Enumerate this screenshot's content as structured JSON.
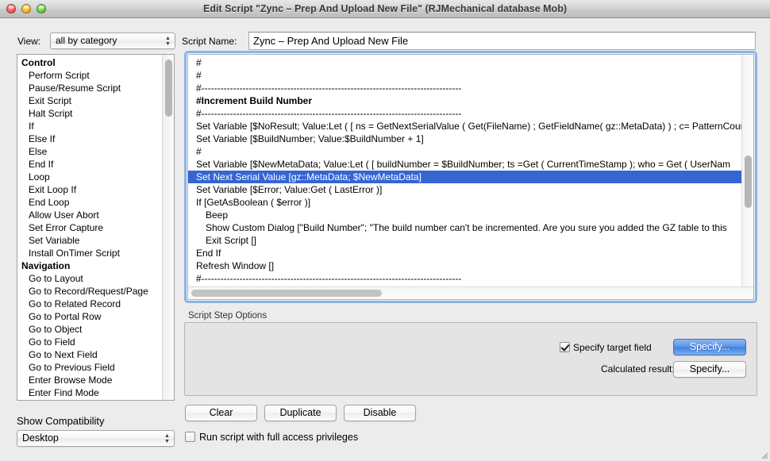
{
  "window": {
    "title": "Edit Script \"Zync – Prep And Upload New File\" (RJMechanical database Mob)",
    "traffic": {
      "close": "close-button",
      "minimize": "minimize-button",
      "zoom": "zoom-button"
    }
  },
  "toolbar": {
    "view_label": "View:",
    "view_value": "all by category",
    "script_name_label": "Script Name:",
    "script_name_value": "Zync – Prep And Upload New File"
  },
  "steps_panel": {
    "items": [
      {
        "label": "Control",
        "category": true
      },
      {
        "label": "Perform Script",
        "category": false
      },
      {
        "label": "Pause/Resume Script",
        "category": false
      },
      {
        "label": "Exit Script",
        "category": false
      },
      {
        "label": "Halt Script",
        "category": false
      },
      {
        "label": "If",
        "category": false
      },
      {
        "label": "Else If",
        "category": false
      },
      {
        "label": "Else",
        "category": false
      },
      {
        "label": "End If",
        "category": false
      },
      {
        "label": "Loop",
        "category": false
      },
      {
        "label": "Exit Loop If",
        "category": false
      },
      {
        "label": "End Loop",
        "category": false
      },
      {
        "label": "Allow User Abort",
        "category": false
      },
      {
        "label": "Set Error Capture",
        "category": false
      },
      {
        "label": "Set Variable",
        "category": false
      },
      {
        "label": "Install OnTimer Script",
        "category": false
      },
      {
        "label": "Navigation",
        "category": true
      },
      {
        "label": "Go to Layout",
        "category": false
      },
      {
        "label": "Go to Record/Request/Page",
        "category": false
      },
      {
        "label": "Go to Related Record",
        "category": false
      },
      {
        "label": "Go to Portal Row",
        "category": false
      },
      {
        "label": "Go to Object",
        "category": false
      },
      {
        "label": "Go to Field",
        "category": false
      },
      {
        "label": "Go to Next Field",
        "category": false
      },
      {
        "label": "Go to Previous Field",
        "category": false
      },
      {
        "label": "Enter Browse Mode",
        "category": false
      },
      {
        "label": "Enter Find Mode",
        "category": false
      }
    ]
  },
  "script_body": {
    "lines": [
      {
        "text": "#",
        "indent": 0,
        "bold": false,
        "selected": false
      },
      {
        "text": "#",
        "indent": 0,
        "bold": false,
        "selected": false
      },
      {
        "text": "#----------------------------------------------------------------------------------",
        "indent": 0,
        "bold": false,
        "selected": false
      },
      {
        "text": "#Increment Build Number",
        "indent": 0,
        "bold": true,
        "selected": false
      },
      {
        "text": "#----------------------------------------------------------------------------------",
        "indent": 0,
        "bold": false,
        "selected": false
      },
      {
        "text": "Set Variable [$NoResult; Value:Let ( [ ns = GetNextSerialValue ( Get(FileName) ; GetFieldName( gz::MetaData) ) ; c= PatternCoun",
        "indent": 0,
        "bold": false,
        "selected": false
      },
      {
        "text": "Set Variable [$BuildNumber; Value:$BuildNumber + 1]",
        "indent": 0,
        "bold": false,
        "selected": false
      },
      {
        "text": "#",
        "indent": 0,
        "bold": false,
        "selected": false
      },
      {
        "text": "Set Variable [$NewMetaData; Value:Let ( [ buildNumber = $BuildNumber;  ts =Get ( CurrentTimeStamp ); who = Get ( UserNam",
        "indent": 0,
        "bold": false,
        "selected": false
      },
      {
        "text": "Set Next Serial Value [gz::MetaData; $NewMetaData]",
        "indent": 0,
        "bold": false,
        "selected": true
      },
      {
        "text": "Set Variable [$Error; Value:Get ( LastError )]",
        "indent": 0,
        "bold": false,
        "selected": false
      },
      {
        "text": "If [GetAsBoolean ( $error )]",
        "indent": 0,
        "bold": false,
        "selected": false
      },
      {
        "text": "Beep",
        "indent": 1,
        "bold": false,
        "selected": false
      },
      {
        "text": "Show Custom Dialog [\"Build Number\"; \"The build number can't be incremented.  Are you sure you added the GZ table to this",
        "indent": 1,
        "bold": false,
        "selected": false
      },
      {
        "text": "Exit Script []",
        "indent": 1,
        "bold": false,
        "selected": false
      },
      {
        "text": "End If",
        "indent": 0,
        "bold": false,
        "selected": false
      },
      {
        "text": "Refresh Window []",
        "indent": 0,
        "bold": false,
        "selected": false
      },
      {
        "text": "#----------------------------------------------------------------------------------",
        "indent": 0,
        "bold": false,
        "selected": false
      },
      {
        "text": "#",
        "indent": 0,
        "bold": false,
        "selected": false
      }
    ]
  },
  "options": {
    "caption": "Script Step Options",
    "specify_target_field_label": "Specify target field",
    "specify_target_field_checked": true,
    "specify_button_1": "Specify...",
    "calculated_result_label": "Calculated result:",
    "specify_button_2": "Specify..."
  },
  "bottom": {
    "clear": "Clear",
    "duplicate": "Duplicate",
    "disable": "Disable",
    "compatibility_label": "Show Compatibility",
    "compatibility_value": "Desktop",
    "full_access_label": "Run script with full access privileges",
    "full_access_checked": false
  },
  "colors": {
    "selection_blue": "#3465d2",
    "focus_ring": "#8cb4e2",
    "default_button": "#5a93e8"
  }
}
